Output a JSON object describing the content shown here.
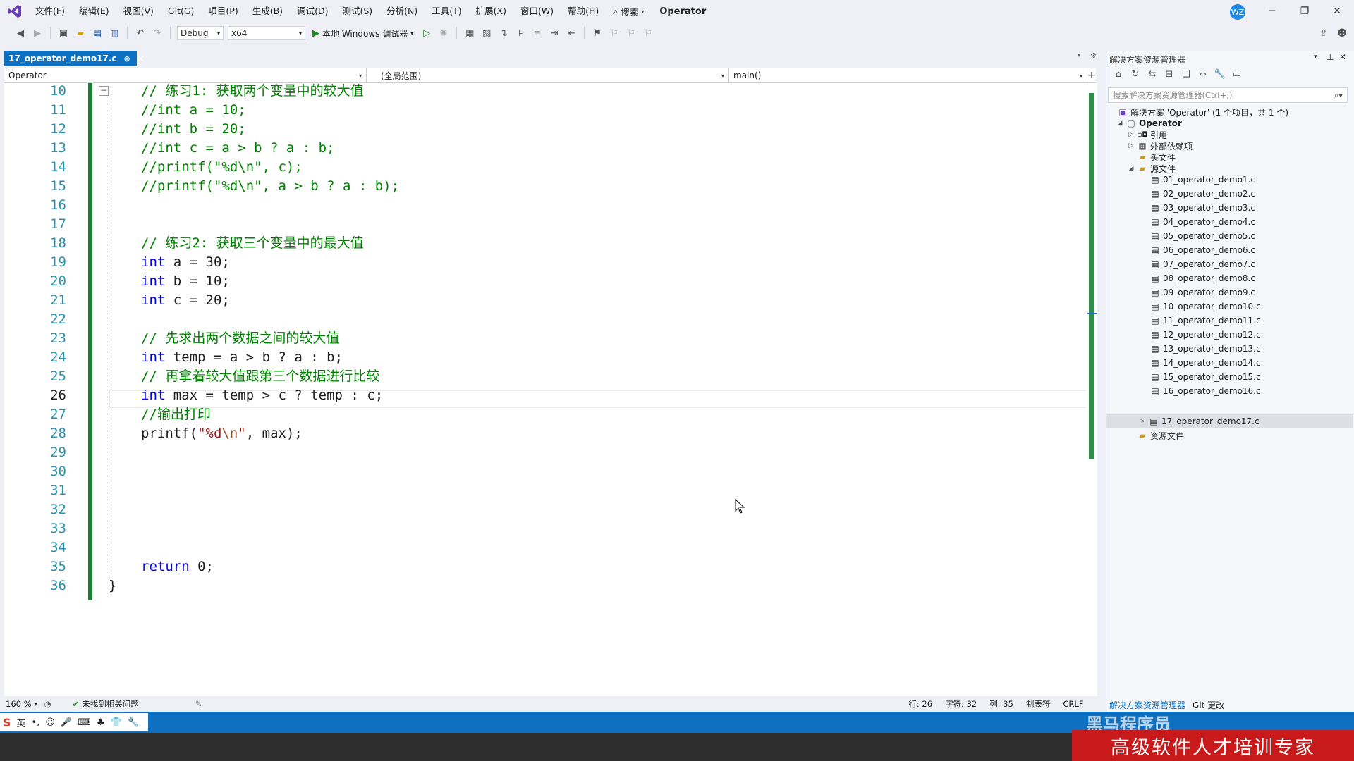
{
  "menubar": {
    "items": [
      "文件(F)",
      "编辑(E)",
      "视图(V)",
      "Git(G)",
      "项目(P)",
      "生成(B)",
      "调试(D)",
      "测试(S)",
      "分析(N)",
      "工具(T)",
      "扩展(X)",
      "窗口(W)",
      "帮助(H)"
    ],
    "search_label": "搜索",
    "solution_title": "Operator",
    "avatar_initials": "WZ"
  },
  "toolbar": {
    "config": "Debug",
    "platform": "x64",
    "run_label": "本地 Windows 调试器"
  },
  "tab": {
    "filename": "17_operator_demo17.c",
    "pin": "⊕",
    "close": "×"
  },
  "navbar": {
    "project": "Operator",
    "scope": "(全局范围)",
    "function": "main()"
  },
  "editor": {
    "current_line": "26",
    "lines": [
      {
        "n": "10",
        "t": "// 练习1: 获取两个变量中的较大值"
      },
      {
        "n": "11",
        "t": "//int a = 10;"
      },
      {
        "n": "12",
        "t": "//int b = 20;"
      },
      {
        "n": "13",
        "t": "//int c = a > b ? a : b;"
      },
      {
        "n": "14",
        "t": "//printf(\"%d\\n\", c);"
      },
      {
        "n": "15",
        "t": "//printf(\"%d\\n\", a > b ? a : b);"
      },
      {
        "n": "16",
        "t": ""
      },
      {
        "n": "17",
        "t": ""
      },
      {
        "n": "18",
        "t": "// 练习2: 获取三个变量中的最大值"
      },
      {
        "n": "19",
        "kw": "int",
        "t": " a = 30;"
      },
      {
        "n": "20",
        "kw": "int",
        "t": " b = 10;"
      },
      {
        "n": "21",
        "kw": "int",
        "t": " c = 20;"
      },
      {
        "n": "22",
        "t": ""
      },
      {
        "n": "23",
        "t": "// 先求出两个数据之间的较大值"
      },
      {
        "n": "24",
        "kw": "int",
        "t": " temp = a > b ? a : b;"
      },
      {
        "n": "25",
        "t": "// 再拿着较大值跟第三个数据进行比较"
      },
      {
        "n": "26",
        "kw": "int",
        "t": " max = temp > c ? temp : c;"
      },
      {
        "n": "27",
        "t": "//输出打印"
      },
      {
        "n": "28",
        "t": "printf(\"%d\\n\", max);"
      },
      {
        "n": "29",
        "t": ""
      },
      {
        "n": "30",
        "t": ""
      },
      {
        "n": "31",
        "t": ""
      },
      {
        "n": "32",
        "t": ""
      },
      {
        "n": "33",
        "t": ""
      },
      {
        "n": "34",
        "t": ""
      },
      {
        "n": "35",
        "kw": "return",
        "t": " 0;"
      },
      {
        "n": "36",
        "t": "}"
      }
    ]
  },
  "code_text": {
    "l10": "// 练习1: 获取两个变量中的较大值",
    "l11": "//int a = 10;",
    "l12": "//int b = 20;",
    "l13": "//int c = a > b ? a : b;",
    "l14": "//printf(\"%d\\n\", c);",
    "l15": "//printf(\"%d\\n\", a > b ? a : b);",
    "l18": "// 练习2: 获取三个变量中的最大值",
    "kw_int": "int",
    "l19": " a = 30;",
    "l20": " b = 10;",
    "l21": " c = 20;",
    "l23": "// 先求出两个数据之间的较大值",
    "l24": " temp = a > b ? a : b;",
    "l25": "// 再拿着较大值跟第三个数据进行比较",
    "l26": " max = temp > c ? temp : c;",
    "l27": "//输出打印",
    "l28_fn": "printf(",
    "l28_str1": "\"%d",
    "l28_esc": "\\n",
    "l28_str2": "\"",
    "l28_rest": ", max);",
    "kw_return": "return",
    "l35": " 0;",
    "l36": "}"
  },
  "statusbar": {
    "zoom": "160 %",
    "issues": "未找到相关问题",
    "row": "行: 26",
    "char": "字符: 32",
    "col": "列: 35",
    "tabs": "制表符",
    "eol": "CRLF"
  },
  "solution_explorer": {
    "title": "解决方案资源管理器",
    "search_placeholder": "搜索解决方案资源管理器(Ctrl+;)",
    "solution": "解决方案 'Operator' (1 个项目，共 1 个)",
    "project": "Operator",
    "references": "引用",
    "external_deps": "外部依赖项",
    "headers": "头文件",
    "sources": "源文件",
    "resources": "资源文件",
    "files": [
      "01_operator_demo1.c",
      "02_operator_demo2.c",
      "03_operator_demo3.c",
      "04_operator_demo4.c",
      "05_operator_demo5.c",
      "06_operator_demo6.c",
      "07_operator_demo7.c",
      "08_operator_demo8.c",
      "09_operator_demo9.c",
      "10_operator_demo10.c",
      "11_operator_demo11.c",
      "12_operator_demo12.c",
      "13_operator_demo13.c",
      "14_operator_demo14.c",
      "15_operator_demo15.c",
      "16_operator_demo16.c",
      "17_operator_demo17.c"
    ],
    "tab_explorer": "解决方案资源管理器",
    "tab_git": "Git 更改"
  },
  "ime": {
    "lang": "英"
  },
  "overlay": {
    "brand_slogan": "高级软件人才培训专家",
    "brand_name": "黑马程序员"
  },
  "colors": {
    "accent": "#0e70c0",
    "green_change_bar": "#1a7f37",
    "comment": "#008000",
    "keyword": "#0000ff",
    "string": "#a31515",
    "banner_red": "#c81a1a"
  }
}
